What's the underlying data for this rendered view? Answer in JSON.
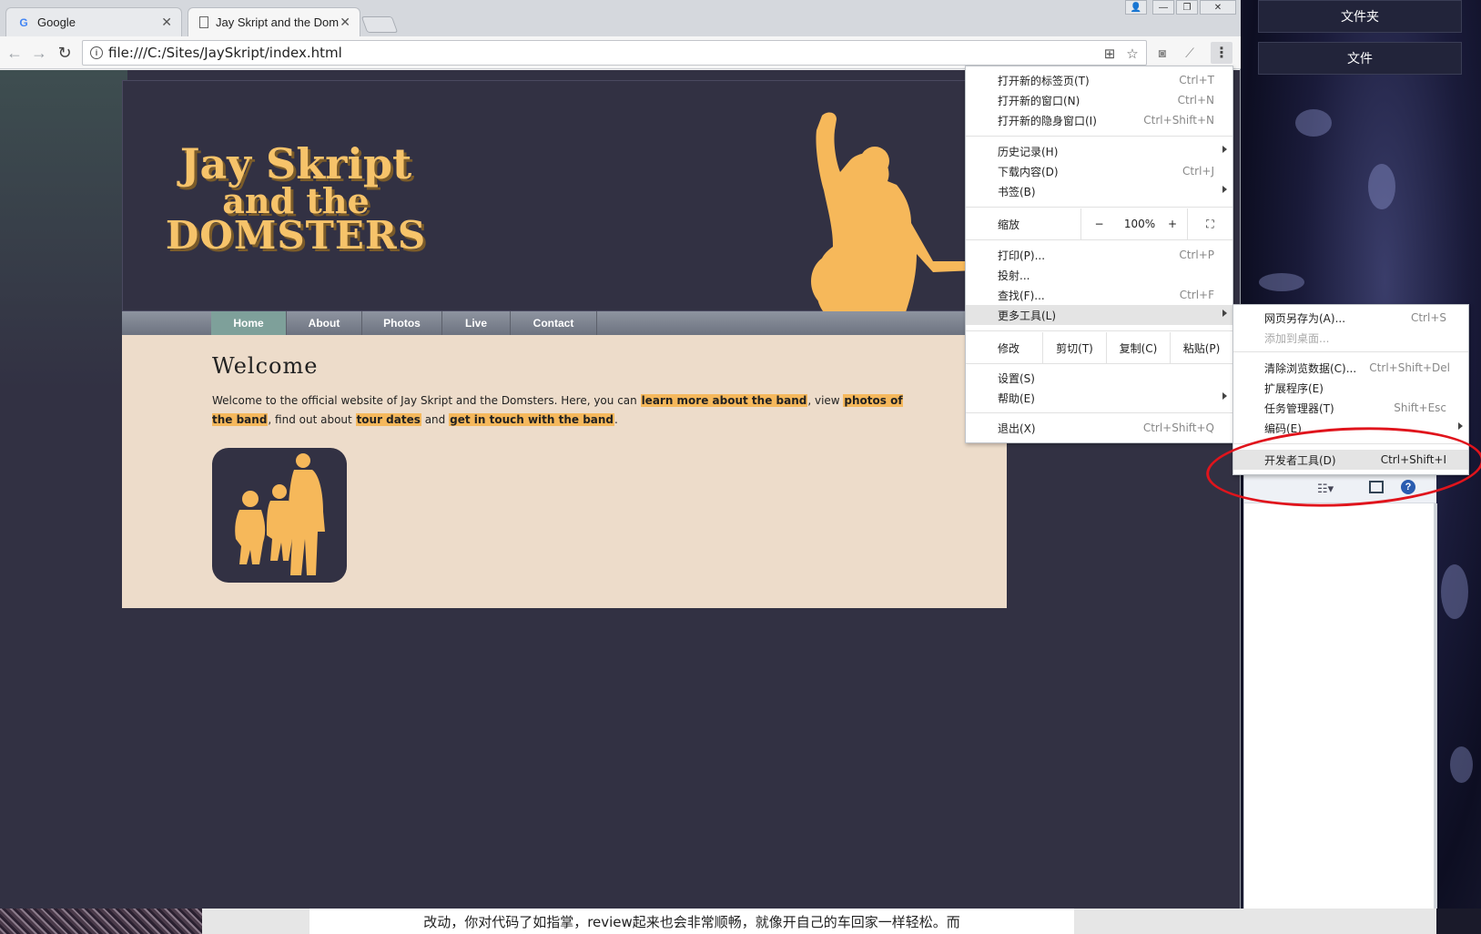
{
  "desktop": {
    "buttons": [
      "文件夹",
      "文件"
    ]
  },
  "browser": {
    "tabs": [
      {
        "title": "Google",
        "icon": "google-g-icon",
        "active": false
      },
      {
        "title": "Jay Skript and the Dom",
        "icon": "page-icon",
        "active": true
      }
    ],
    "url": "file:///C:/Sites/JaySkript/index.html"
  },
  "site": {
    "logo": {
      "line1": "Jay Skript",
      "line2": "and the",
      "line3": "DOMSTERS"
    },
    "nav": [
      "Home",
      "About",
      "Photos",
      "Live",
      "Contact"
    ],
    "current_nav": "Home",
    "heading": "Welcome",
    "intro": {
      "t1": "Welcome to the official website of Jay Skript and the Domsters. Here, you can ",
      "link1": "learn more about the band",
      "t2": ", view ",
      "link2": "photos of the band",
      "t3": ", find out about ",
      "link3": "tour dates",
      "t4": " and ",
      "link4": "get in touch with the band",
      "t5": "."
    },
    "colors": {
      "dark": "#323143",
      "accent": "#f6c36a",
      "highlight": "#f5b85c",
      "body": "#eddcca",
      "nav_current": "#7ea09a"
    }
  },
  "menu": {
    "new_tab": {
      "label": "打开新的标签页(T)",
      "shortcut": "Ctrl+T"
    },
    "new_window": {
      "label": "打开新的窗口(N)",
      "shortcut": "Ctrl+N"
    },
    "incognito": {
      "label": "打开新的隐身窗口(I)",
      "shortcut": "Ctrl+Shift+N"
    },
    "history": {
      "label": "历史记录(H)"
    },
    "downloads": {
      "label": "下载内容(D)",
      "shortcut": "Ctrl+J"
    },
    "bookmarks": {
      "label": "书签(B)"
    },
    "zoom": {
      "label": "缩放",
      "minus": "−",
      "value": "100%",
      "plus": "+"
    },
    "print": {
      "label": "打印(P)...",
      "shortcut": "Ctrl+P"
    },
    "cast": {
      "label": "投射..."
    },
    "find": {
      "label": "查找(F)...",
      "shortcut": "Ctrl+F"
    },
    "more_tools": {
      "label": "更多工具(L)"
    },
    "edit": {
      "label": "修改",
      "cut": "剪切(T)",
      "copy": "复制(C)",
      "paste": "粘贴(P)"
    },
    "settings": {
      "label": "设置(S)"
    },
    "help": {
      "label": "帮助(E)"
    },
    "exit": {
      "label": "退出(X)",
      "shortcut": "Ctrl+Shift+Q"
    }
  },
  "submenu": {
    "save_page": {
      "label": "网页另存为(A)...",
      "shortcut": "Ctrl+S"
    },
    "add_desktop": {
      "label": "添加到桌面..."
    },
    "clear_data": {
      "label": "清除浏览数据(C)...",
      "shortcut": "Ctrl+Shift+Del"
    },
    "extensions": {
      "label": "扩展程序(E)"
    },
    "task_manager": {
      "label": "任务管理器(T)",
      "shortcut": "Shift+Esc"
    },
    "encoding": {
      "label": "编码(E)"
    },
    "devtools": {
      "label": "开发者工具(D)",
      "shortcut": "Ctrl+Shift+I"
    }
  },
  "bottom": {
    "text": "改动，你对代码了如指掌，review起来也会非常顺畅，就像开自己的车回家一样轻松。而"
  },
  "annotation": {
    "color": "#e0141c",
    "target": "开发者工具(D)"
  }
}
